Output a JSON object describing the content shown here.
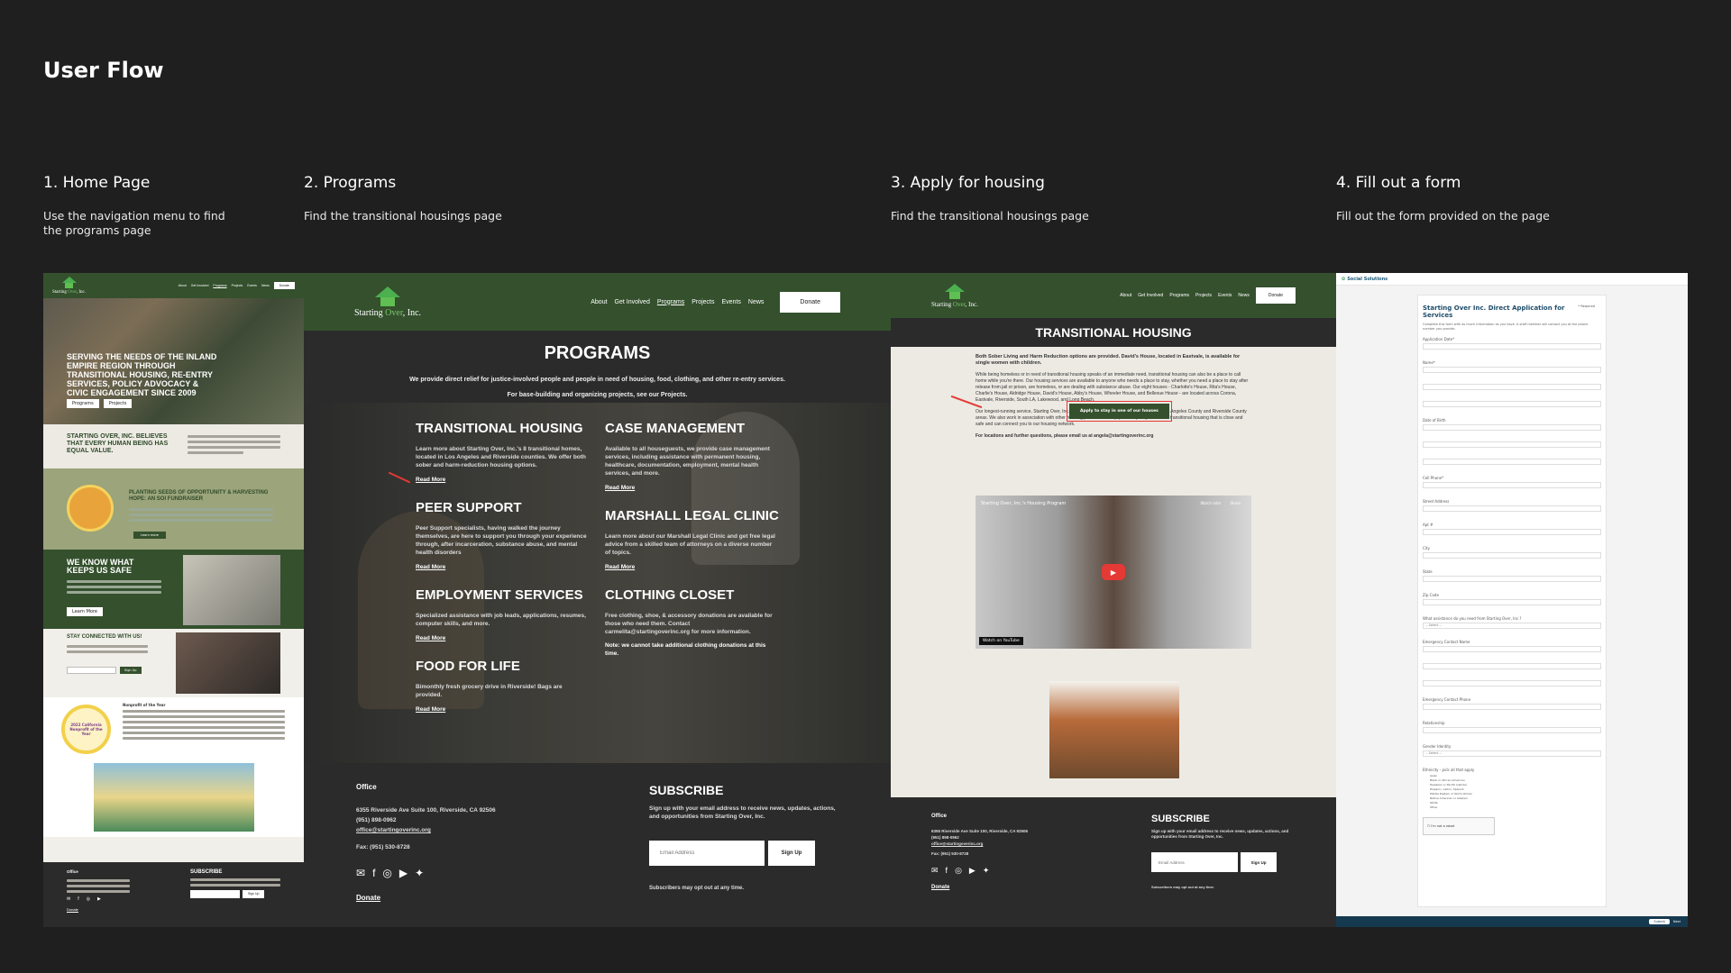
{
  "page_title": "User Flow",
  "steps": [
    {
      "title": "1. Home Page",
      "desc": "Use the navigation menu to find the programs page"
    },
    {
      "title": "2. Programs",
      "desc": "Find the transitional housings page"
    },
    {
      "title": "3. Apply for housing",
      "desc": "Find the transitional housings page"
    },
    {
      "title": "4. Fill out a form",
      "desc": "Fill out the form provided on the page"
    }
  ],
  "logo": {
    "starting": "Starting",
    "over": "Over",
    "inc": ", Inc."
  },
  "nav": [
    "About",
    "Get Involved",
    "Programs",
    "Projects",
    "Events",
    "News"
  ],
  "donate": "Donate",
  "home": {
    "hero": "SERVING THE NEEDS OF THE INLAND EMPIRE REGION THROUGH TRANSITIONAL HOUSING, RE-ENTRY SERVICES, POLICY ADVOCACY & CIVIC ENGAGEMENT SINCE 2009",
    "hero_btn1": "Programs",
    "hero_btn2": "Projects",
    "believe": "STARTING OVER, INC. BELIEVES THAT EVERY HUMAN BEING HAS EQUAL VALUE.",
    "fundraiser": "PLANTING SEEDS OF OPPORTUNITY & HARVESTING HOPE: AN SOI FUNDRAISER",
    "fundraiser_btn": "Learn more",
    "safe": "WE KNOW WHAT KEEPS US SAFE",
    "safe_btn": "Learn More",
    "stay": "STAY CONNECTED WITH US!",
    "stay_btn": "Sign Up",
    "nonprofit": "Nonprofit of the Year",
    "badge": "2022 California Nonprofit of the Year",
    "footer_office": "Office",
    "footer_subscribe": "SUBSCRIBE",
    "footer_signup": "Sign Up",
    "footer_donate": "Donate"
  },
  "programs": {
    "title": "PROGRAMS",
    "sub1": "We provide direct relief for justice-involved people and people in need of housing, food, clothing, and other re-entry services.",
    "sub2": "For base-building and organizing projects, see our Projects.",
    "items": [
      {
        "title": "TRANSITIONAL HOUSING",
        "desc": "Learn more about Starting Over, Inc.'s 8 transitional homes, located in Los Angeles and Riverside counties. We offer both sober and harm-reduction housing options.",
        "link": "Read More"
      },
      {
        "title": "CASE MANAGEMENT",
        "desc": "Available to all houseguests, we provide case management services, including assistance with permanent housing, healthcare, documentation, employment, mental health services, and more.",
        "link": "Read More"
      },
      {
        "title": "PEER SUPPORT",
        "desc": "Peer Support specialists, having walked the journey themselves, are here to support you through your experience through, after incarceration, substance abuse, and mental health disorders",
        "link": "Read More"
      },
      {
        "title": "MARSHALL LEGAL CLINIC",
        "desc": "Learn more about our Marshall Legal Clinic and get free legal advice from a skilled team of attorneys on a diverse number of topics.",
        "link": "Read More"
      },
      {
        "title": "EMPLOYMENT SERVICES",
        "desc": "Specialized assistance with job leads, applications, resumes, computer skills, and more.",
        "link": "Read More"
      },
      {
        "title": "CLOTHING CLOSET",
        "desc": "Free clothing, shoe, & accessory donations are available for those who need them. Contact carmelita@startingoverinc.org for more information.",
        "link": "Note: we cannot take additional clothing donations at this time."
      },
      {
        "title": "FOOD FOR LIFE",
        "desc": "Bimonthly fresh grocery drive in Riverside! Bags are provided.",
        "link": "Read More"
      }
    ],
    "footer": {
      "office": "Office",
      "address": "6355 Riverside Ave Suite 100, Riverside, CA  92506",
      "phone": "(951) 898-0962",
      "email": "office@startingoverinc.org",
      "fax": "Fax: (951) 530-8728",
      "donate": "Donate",
      "subscribe": "SUBSCRIBE",
      "subscribe_desc": "Sign up with your email address to receive news, updates, actions, and opportunities from Starting Over, Inc.",
      "email_placeholder": "Email Address",
      "signup": "Sign Up",
      "optout": "Subscribers may opt out at any time."
    }
  },
  "housing": {
    "title": "TRANSITIONAL HOUSING",
    "intro": "Both Sober Living and Harm Reduction options are provided. David's House, located in Eastvale, is available for single women with children.",
    "body1": "While being homeless or in need of transitional housing speaks of an immediate need, transitional housing can also be a place to call home while you're there. Our housing services are available to anyone who needs a place to stay, whether you need a place to stay after release from jail or prison, are homeless, or are dealing with substance abuse. Our eight houses - Charlotte's House, Rita's House, Charlie's House, Aldridge House, David's House, Abby's House, Wheeler House, and Bellevue House - are located across Corona, Eastvale, Riverside, South LA, Lakewood, and Long Beach.",
    "body2": "Our longest-running service, Starting Over, Inc. currently owns eight transitional homes in the Los Angeles County and Riverside County areas. We also work in association with other housing providers to help provide quality affordable transitional housing that is close and safe and can connect you to our housing network.",
    "contact": "For locations and further questions, please email us at angela@startingoverinc.org",
    "apply_btn": "Apply to stay in one of our houses",
    "video_title": "Starting Over, Inc.'s Housing Program",
    "watch_later": "Watch later",
    "share": "Share",
    "watch_on": "Watch on",
    "youtube": "YouTube"
  },
  "form": {
    "brand": "Social Solutions",
    "title": "Starting Over Inc. Direct Application for Services",
    "required": "* Required",
    "intro": "Complete this form with as much information as you have. A staff member will contact you at the phone number you provide.",
    "fields": [
      "Application Date*",
      "Name*",
      "Date of Birth",
      "Cell Phone*",
      "Street Address",
      "Apt #",
      "City",
      "State",
      "Zip Code",
      "What assistance do you need from Starting Over, Inc.?",
      "Emergency Contact Name",
      "Emergency Contact Phone",
      "Relationship",
      "Gender Identity",
      "Ethnicity - pick all that apply"
    ],
    "ethnicities": [
      "Asian",
      "Black or African American",
      "Hawaiian or Pacific Islander",
      "Hispanic, Latino, Spanish",
      "Middle Eastern or North African",
      "Native American or Alaskan",
      "White",
      "Other"
    ],
    "select_placeholder": "-- Select --",
    "captcha": "I'm not a robot",
    "submit": "Submit",
    "next": "Next"
  },
  "colors": {
    "green": "#34502d",
    "dark": "#2b2b2b",
    "accent_red": "#e53935",
    "cream": "#eceae3"
  }
}
